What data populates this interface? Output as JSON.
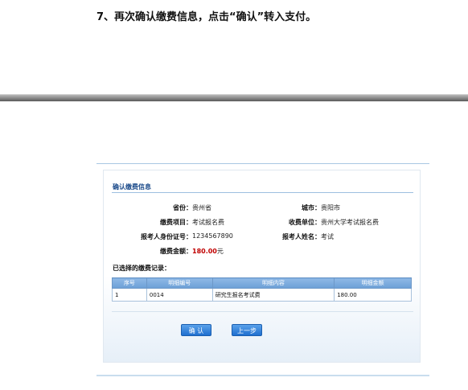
{
  "instruction": "7、再次确认缴费信息，点击“确认”转入支付。",
  "panel": {
    "title": "确认缴费信息",
    "fields": {
      "province_label": "省份：",
      "province_value": "贵州省",
      "city_label": "城市：",
      "city_value": "贵阳市",
      "item_label": "缴费项目：",
      "item_value": "考试报名费",
      "unit_label": "收费单位：",
      "unit_value": "贵州大学考试报名费",
      "id_label": "报考人身份证号：",
      "id_value": "1234567890",
      "name_label": "报考人姓名：",
      "name_value": "考试",
      "amount_label": "缴费金额：",
      "amount_value": "180.00",
      "amount_unit": "元"
    },
    "records_title": "已选择的缴费记录：",
    "table": {
      "headers": [
        "序号",
        "明细编号",
        "明细内容",
        "明细金额"
      ],
      "rows": [
        [
          "1",
          "0014",
          "研究生报名考试费",
          "180.00"
        ]
      ]
    },
    "buttons": {
      "confirm": "确 认",
      "back": "上一步"
    }
  },
  "colors": {
    "accent": "#1f6fcf",
    "amount": "#c00000",
    "table_header": "#7aaadd"
  }
}
